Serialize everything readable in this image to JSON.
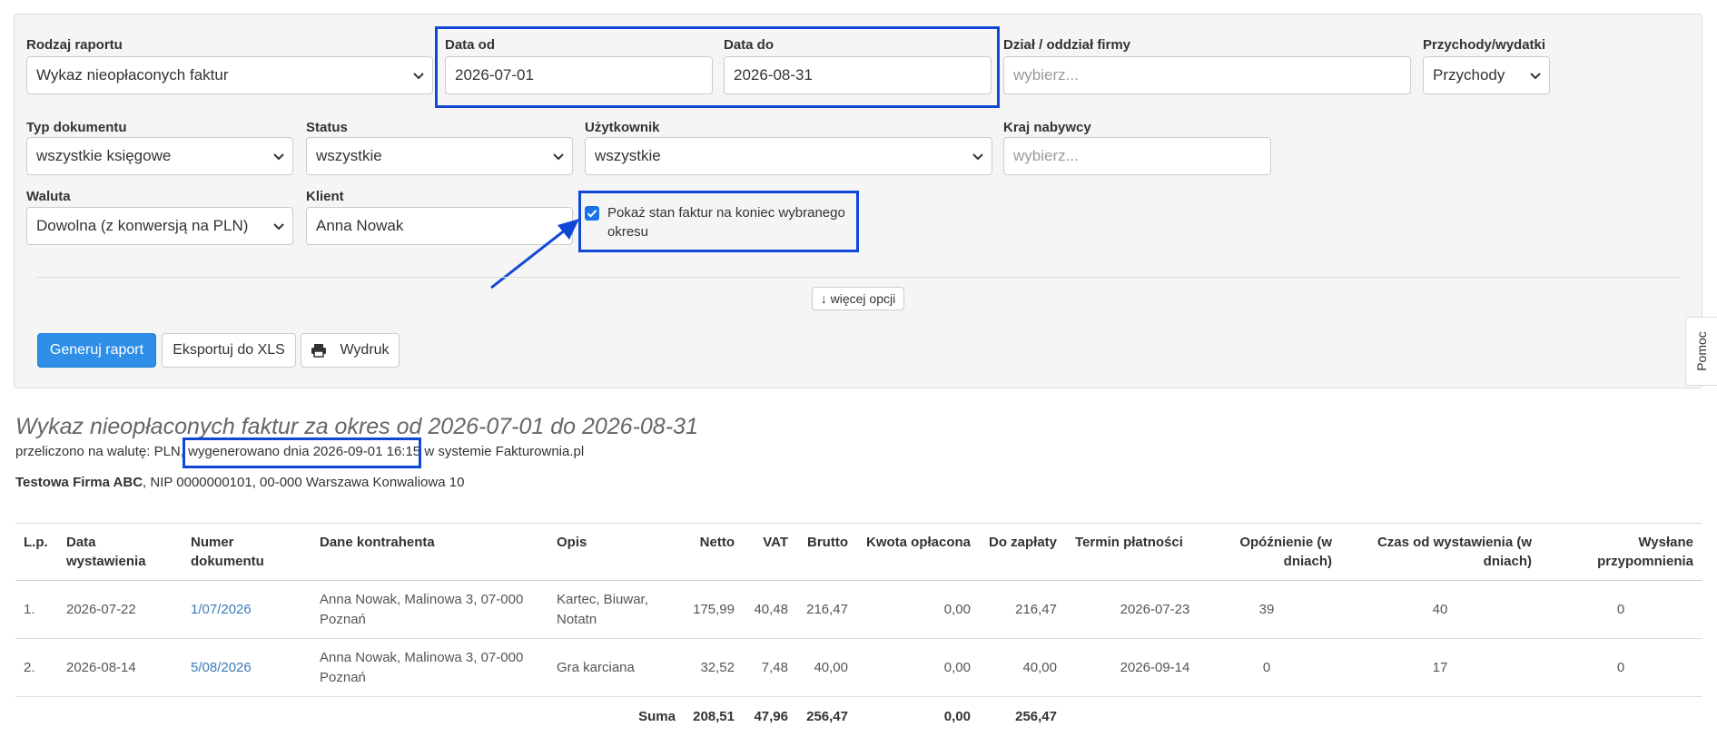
{
  "filters": {
    "rodzaj": {
      "label": "Rodzaj raportu",
      "value": "Wykaz nieopłaconych faktur"
    },
    "data_od": {
      "label": "Data od",
      "value": "2026-07-01"
    },
    "data_do": {
      "label": "Data do",
      "value": "2026-08-31"
    },
    "dzial": {
      "label": "Dział / oddział firmy",
      "placeholder": "wybierz..."
    },
    "przychody": {
      "label": "Przychody/wydatki",
      "value": "Przychody"
    },
    "typ": {
      "label": "Typ dokumentu",
      "value": "wszystkie księgowe"
    },
    "status": {
      "label": "Status",
      "value": "wszystkie"
    },
    "uzytkownik": {
      "label": "Użytkownik",
      "value": "wszystkie"
    },
    "kraj": {
      "label": "Kraj nabywcy",
      "placeholder": "wybierz..."
    },
    "waluta": {
      "label": "Waluta",
      "value": "Dowolna (z konwersją na PLN)"
    },
    "klient": {
      "label": "Klient",
      "value": "Anna Nowak"
    },
    "stan": {
      "label_line1": "Pokaż stan faktur na koniec wybranego",
      "label_line2": "okresu",
      "checked": true
    }
  },
  "more_options": "↓ więcej opcji",
  "buttons": {
    "generate": "Generuj raport",
    "export": "Eksportuj do XLS",
    "print": "Wydruk"
  },
  "help_tab": "Pomoc",
  "report": {
    "title": "Wykaz nieopłaconych faktur za okres od 2026-07-01 do 2026-08-31",
    "meta_prefix": "przeliczono na walutę: PLN,",
    "meta_generated": "wygenerowano dnia 2026-09-01 16:15",
    "meta_suffix": "w systemie Fakturownia.pl",
    "company_name": "Testowa Firma ABC",
    "company_details": ", NIP 0000000101, 00-000 Warszawa Konwaliowa 10"
  },
  "table": {
    "headers": {
      "lp": "L.p.",
      "data_1": "Data",
      "data_2": "wystawienia",
      "numer_1": "Numer",
      "numer_2": "dokumentu",
      "kontrahent": "Dane kontrahenta",
      "opis": "Opis",
      "netto": "Netto",
      "vat": "VAT",
      "brutto": "Brutto",
      "oplacona": "Kwota opłacona",
      "dozaplaty": "Do zapłaty",
      "termin": "Termin płatności",
      "opoznienie_1": "Opóźnienie (w",
      "opoznienie_2": "dniach)",
      "czas_1": "Czas od wystawienia (w",
      "czas_2": "dniach)",
      "wyslane_1": "Wysłane",
      "wyslane_2": "przypomnienia"
    },
    "rows": [
      {
        "lp": "1.",
        "data": "2026-07-22",
        "numer": "1/07/2026",
        "kontrahent_1": "Anna Nowak, Malinowa 3, 07-000",
        "kontrahent_2": "Poznań",
        "opis_1": "Kartec, Biuwar,",
        "opis_2": "Notatn",
        "netto": "175,99",
        "vat": "40,48",
        "brutto": "216,47",
        "oplacona": "0,00",
        "dozaplaty": "216,47",
        "termin": "2026-07-23",
        "opoznienie": "39",
        "czas": "40",
        "wyslane": "0"
      },
      {
        "lp": "2.",
        "data": "2026-08-14",
        "numer": "5/08/2026",
        "kontrahent_1": "Anna Nowak, Malinowa 3, 07-000",
        "kontrahent_2": "Poznań",
        "opis_1": "Gra karciana",
        "opis_2": "",
        "netto": "32,52",
        "vat": "7,48",
        "brutto": "40,00",
        "oplacona": "0,00",
        "dozaplaty": "40,00",
        "termin": "2026-09-14",
        "opoznienie": "0",
        "czas": "17",
        "wyslane": "0"
      }
    ],
    "sum": {
      "label": "Suma",
      "netto": "208,51",
      "vat": "47,96",
      "brutto": "256,47",
      "oplacona": "0,00",
      "dozaplaty": "256,47"
    }
  },
  "colors": {
    "highlight": "#1048d6",
    "primary": "#2e8ee8",
    "link": "#3a7ab8"
  }
}
